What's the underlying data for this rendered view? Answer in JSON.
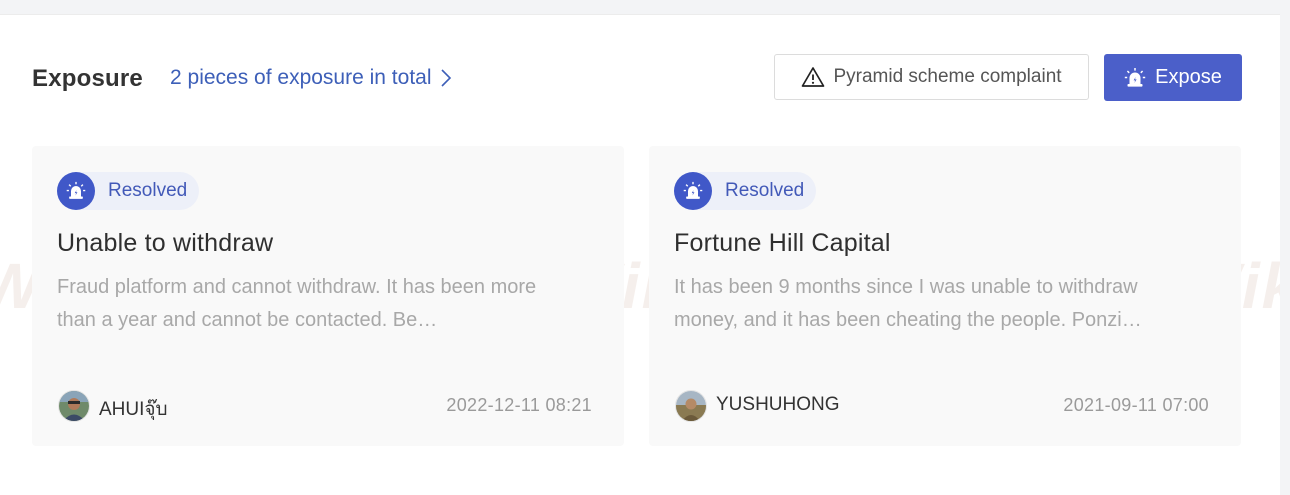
{
  "header": {
    "title": "Exposure",
    "total_link": "2 pieces of exposure in total",
    "complaint_button": "Pyramid scheme complaint",
    "expose_button": "Expose"
  },
  "cards": [
    {
      "status": "Resolved",
      "title": "Unable to withdraw",
      "description": "Fraud platform and cannot withdraw. It has been more than a year and cannot be contacted. Be…",
      "username": "AHUIจุ๊บ",
      "date": "2022-12-11 08:21"
    },
    {
      "status": "Resolved",
      "title": "Fortune Hill Capital",
      "description": "It has been 9 months since I was unable to withdraw money, and it has been cheating the people. Ponzi…",
      "username": "YUSHUHONG",
      "date": "2021-09-11 07:00"
    }
  ],
  "watermark": "WikiFX",
  "colors": {
    "accent": "#4b5fc9",
    "link": "#3d5fb8",
    "status_bg": "#edf0f9"
  },
  "icons": {
    "complaint": "warning-triangle-icon",
    "expose": "alarm-siren-icon",
    "status": "alarm-siren-icon",
    "link": "chevron-right-icon"
  }
}
